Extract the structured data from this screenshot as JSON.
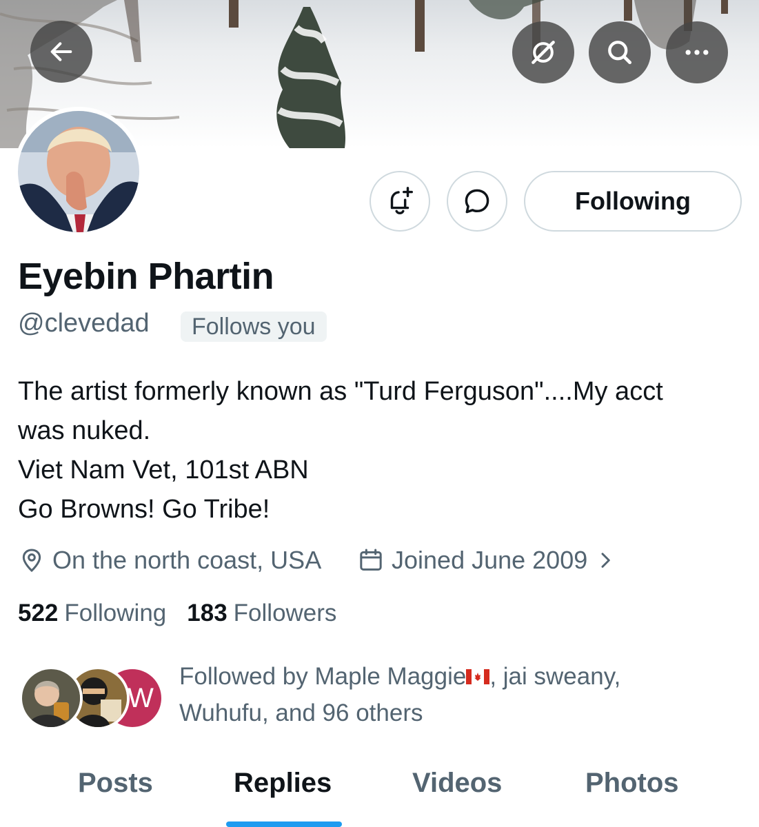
{
  "banner": {
    "back_icon": "arrow-left-icon",
    "grok_icon": "grok-icon",
    "search_icon": "search-icon",
    "more_icon": "more-horizontal-icon"
  },
  "profile": {
    "display_name": "Eyebin Phartin",
    "handle": "@clevedad",
    "follows_you": "Follows you",
    "bio_lines": [
      "The artist formerly known as \"Turd Ferguson\"....My acct",
      "was nuked.",
      "Viet Nam Vet, 101st ABN",
      "Go Browns! Go Tribe!"
    ],
    "location": "On the north coast, USA",
    "joined": "Joined June 2009",
    "following_count": "522",
    "following_label": "Following",
    "followers_count": "183",
    "followers_label": "Followers"
  },
  "actions": {
    "notify_icon": "bell-plus-icon",
    "message_icon": "chat-bubble-icon",
    "following_button": "Following"
  },
  "followed_by": {
    "line1_prefix": "Followed by Maple Maggie",
    "line1_suffix": ", jai sweany,",
    "line2": "Wuhufu, and 96 others",
    "flag": "canada-flag",
    "third_avatar_letter": "W"
  },
  "tabs": [
    {
      "label": "Posts"
    },
    {
      "label": "Replies"
    },
    {
      "label": "Videos"
    },
    {
      "label": "Photos"
    }
  ],
  "active_tab": "Replies",
  "colors": {
    "accent": "#1d9bf0",
    "secondary_text": "#536471",
    "primary_text": "#0f1419",
    "border": "#cfd9de"
  }
}
